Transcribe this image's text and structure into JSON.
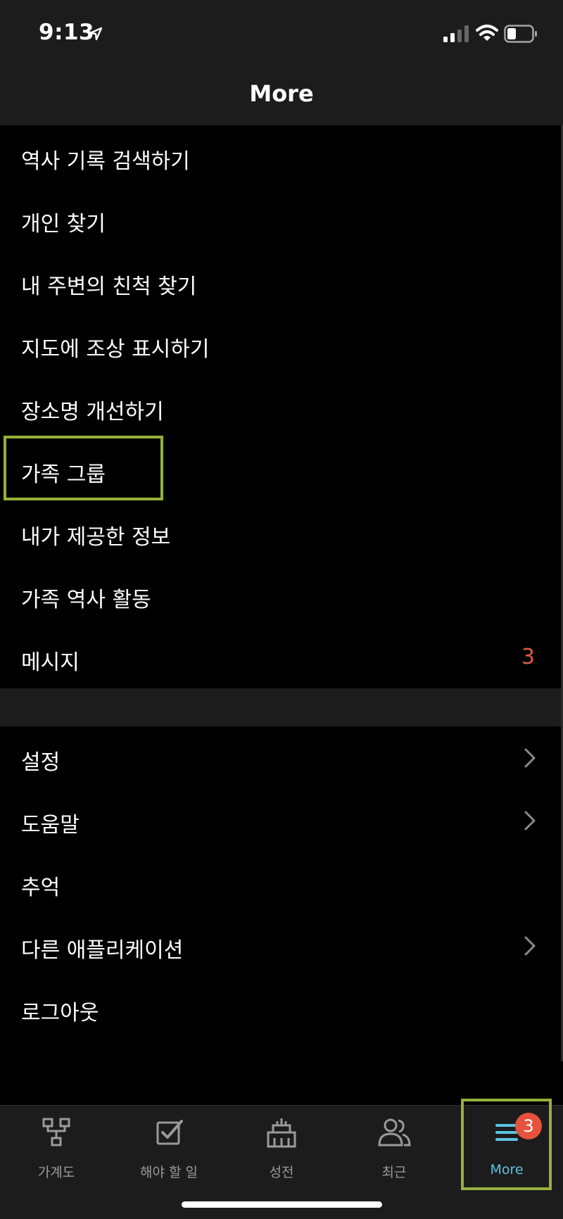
{
  "status_bar": {
    "time": "9:13",
    "icons": [
      "location-arrow-icon",
      "signal-icon",
      "wifi-icon",
      "battery-icon"
    ]
  },
  "header": {
    "title": "More"
  },
  "menu": {
    "items": [
      {
        "label": "역사 기록 검색하기"
      },
      {
        "label": "개인 찾기"
      },
      {
        "label": "내 주변의 친척 찾기"
      },
      {
        "label": "지도에 조상 표시하기"
      },
      {
        "label": "장소명 개선하기"
      },
      {
        "label": "가족 그룹"
      },
      {
        "label": "내가 제공한 정보"
      },
      {
        "label": "가족 역사 활동"
      },
      {
        "label": "메시지",
        "badge": "3"
      }
    ]
  },
  "settings_menu": {
    "items": [
      {
        "label": "설정",
        "icon": "chevron-right-icon"
      },
      {
        "label": "도움말",
        "icon": "chevron-right-icon"
      },
      {
        "label": "추억"
      },
      {
        "label": "다른 애플리케이션",
        "icon": "chevron-right-icon"
      },
      {
        "label": "로그아웃"
      }
    ]
  },
  "tabbar": {
    "tabs": [
      {
        "label": "가계도",
        "icon": "tree-icon"
      },
      {
        "label": "해야 할 일",
        "icon": "checkbox-icon"
      },
      {
        "label": "성전",
        "icon": "temple-icon"
      },
      {
        "label": "최근",
        "icon": "people-icon"
      },
      {
        "label": "More",
        "icon": "menu-icon",
        "badge": "3",
        "active": true
      }
    ]
  },
  "colors": {
    "background": "#000000",
    "header": "#1c1c1d",
    "badge": "#e05a47",
    "active_tab": "#5cc4e0",
    "highlight_box": "#96b03d"
  }
}
